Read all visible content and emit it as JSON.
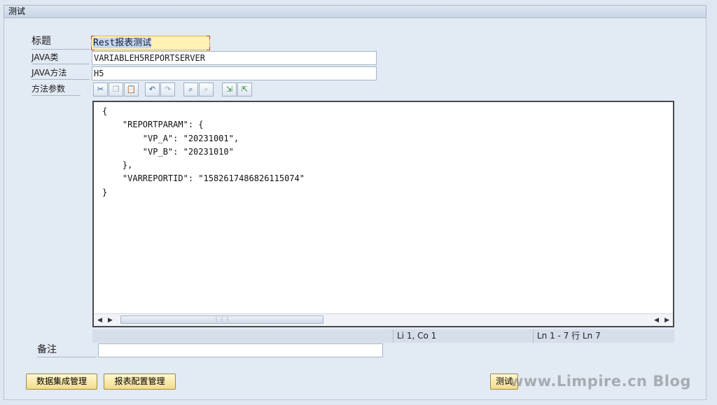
{
  "panel": {
    "title": "测试"
  },
  "form": {
    "title_label": "标题",
    "title_value": "Rest报表测试",
    "java_class_label": "JAVA类",
    "java_class_value": "VARIABLEH5REPORTSERVER",
    "java_method_label": "JAVA方法",
    "java_method_value": "H5",
    "params_label": "方法参数",
    "remark_label": "备注",
    "remark_value": ""
  },
  "toolbar": {
    "icons": [
      "cut-icon",
      "copy-icon",
      "paste-icon",
      "undo-icon",
      "redo-icon",
      "find-icon",
      "find-next-icon",
      "import-icon",
      "export-icon"
    ]
  },
  "editor": {
    "code": "{\n    \"REPORTPARAM\": {\n        \"VP_A\": \"20231001\",\n        \"VP_B\": \"20231010\"\n    },\n    \"VARREPORTID\": \"1582617486826115074\"\n}"
  },
  "status": {
    "cursor": "Li 1, Co 1",
    "lines": "Ln 1 - 7 行 Ln 7"
  },
  "buttons": {
    "data_integration": "数据集成管理",
    "report_config": "报表配置管理",
    "test": "测试"
  },
  "watermark": "www.Limpire.cn Blog"
}
